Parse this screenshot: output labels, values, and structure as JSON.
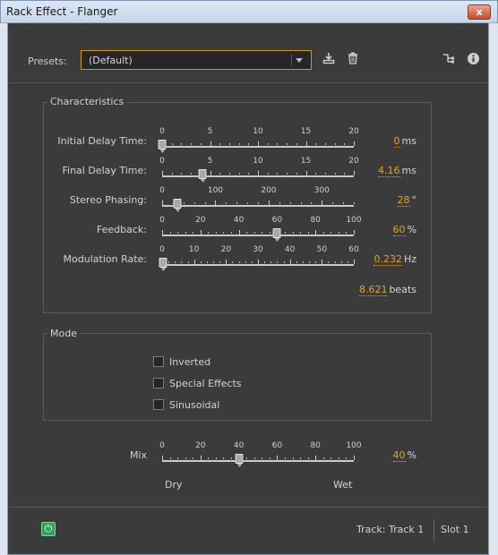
{
  "window": {
    "title": "Rack Effect - Flanger",
    "close_glyph": "x"
  },
  "presets": {
    "label": "Presets:",
    "value": "(Default)",
    "icons": [
      "save-preset-icon",
      "delete-preset-icon",
      "routing-icon",
      "info-icon"
    ]
  },
  "characteristics": {
    "legend": "Characteristics",
    "params": [
      {
        "label": "Initial Delay Time:",
        "ticks": [
          "0",
          "5",
          "10",
          "15",
          "20"
        ],
        "min": 0,
        "max": 20,
        "value": 0,
        "value_text": "0",
        "unit": "ms"
      },
      {
        "label": "Final Delay Time:",
        "ticks": [
          "0",
          "5",
          "10",
          "15",
          "20"
        ],
        "min": 0,
        "max": 20,
        "value": 4.16,
        "value_text": "4.16",
        "unit": "ms"
      },
      {
        "label": "Stereo Phasing:",
        "ticks": [
          "0",
          "100",
          "200",
          "300"
        ],
        "min": 0,
        "max": 360,
        "value": 28,
        "value_text": "28",
        "unit": "°"
      },
      {
        "label": "Feedback:",
        "ticks": [
          "0",
          "20",
          "40",
          "60",
          "80",
          "100"
        ],
        "min": 0,
        "max": 100,
        "value": 60,
        "value_text": "60",
        "unit": "%"
      },
      {
        "label": "Modulation Rate:",
        "ticks": [
          "0",
          "10",
          "20",
          "30",
          "40",
          "50",
          "60"
        ],
        "min": 0,
        "max": 60,
        "value": 0.232,
        "value_text": "0.232",
        "unit": "Hz"
      }
    ],
    "beats_value": "8.621",
    "beats_unit": "beats"
  },
  "mode": {
    "legend": "Mode",
    "options": [
      {
        "label": "Inverted",
        "checked": false
      },
      {
        "label": "Special Effects",
        "checked": false
      },
      {
        "label": "Sinusoidal",
        "checked": false
      }
    ]
  },
  "mix": {
    "label": "Mix",
    "ticks": [
      "0",
      "20",
      "40",
      "60",
      "80",
      "100"
    ],
    "min": 0,
    "max": 100,
    "value": 40,
    "value_text": "40",
    "unit": "%",
    "left_label": "Dry",
    "right_label": "Wet"
  },
  "footer": {
    "power_glyph": "⏻",
    "track": "Track: Track 1",
    "slot": "Slot 1"
  },
  "colors": {
    "accent": "#e0a32a",
    "power": "#2fa15a"
  }
}
